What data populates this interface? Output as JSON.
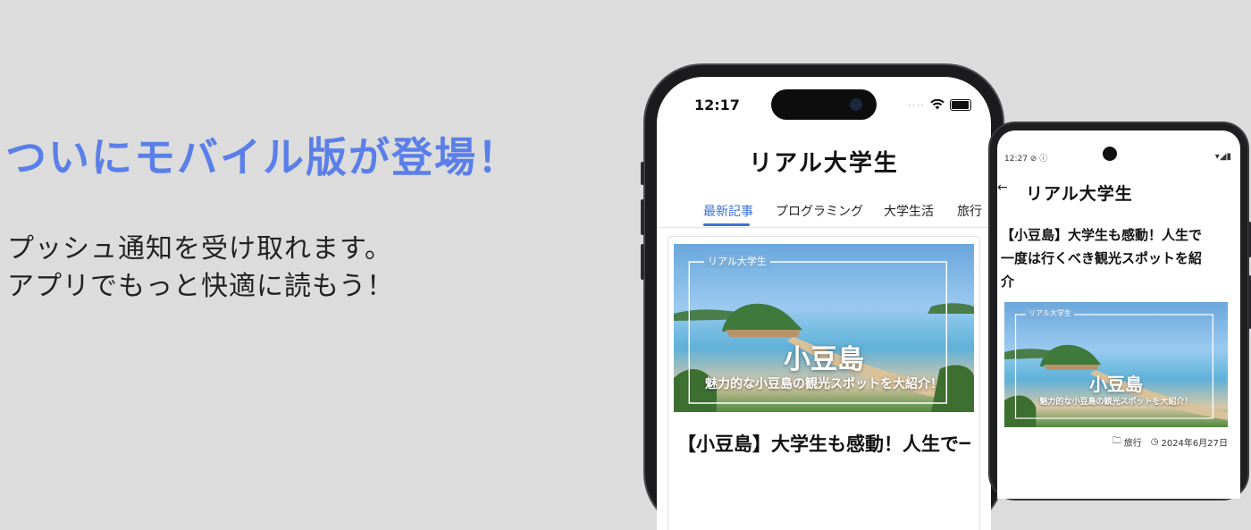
{
  "promo": {
    "headline": "ついにモバイル版が登場！",
    "subtext": [
      "プッシュ通知を受け取れます。",
      "アプリでもっと快適に読もう！"
    ]
  },
  "iphone": {
    "time": "12:17",
    "logo": "リアル大学生",
    "tabs": [
      "最新記事",
      "プログラミング",
      "大学生活",
      "旅行"
    ],
    "active_tab": "最新記事",
    "article": {
      "thumb_brand": "リアル大学生",
      "thumb_title": "小豆島",
      "thumb_caption": "魅力的な小豆島の観光スポットを大紹介！",
      "title": "【小豆島】大学生も感動！人生で一"
    }
  },
  "android": {
    "time": "12:27",
    "status_icons": "▾◢▮",
    "logo": "リアル大学生",
    "article": {
      "title_lines": [
        "【小豆島】大学生も感動！人生で",
        "一度は行くべき観光スポットを紹",
        "介"
      ],
      "thumb_brand": "リアル大学生",
      "thumb_title": "小豆島",
      "thumb_caption": "魅力的な小豆島の観光スポットを大紹介！",
      "category": "旅行",
      "date": "2024年6月27日"
    }
  },
  "colors": {
    "accent": "#5b7fe8",
    "tab_active": "#3b73d6",
    "background": "#dcdcdc"
  }
}
